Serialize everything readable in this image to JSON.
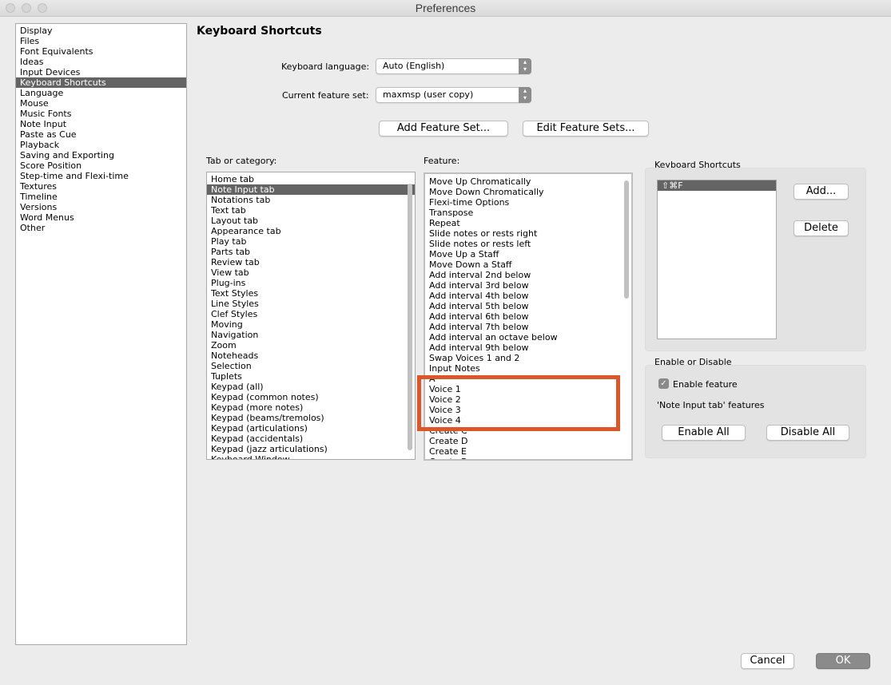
{
  "window": {
    "title": "Preferences"
  },
  "colors": {
    "accent_highlight": "#d9572b",
    "selection": "#646464"
  },
  "sidebar": {
    "items": [
      "Display",
      "Files",
      "Font Equivalents",
      "Ideas",
      "Input Devices",
      "Keyboard Shortcuts",
      "Language",
      "Mouse",
      "Music Fonts",
      "Note Input",
      "Paste as Cue",
      "Playback",
      "Saving and Exporting",
      "Score Position",
      "Step-time and Flexi-time",
      "Textures",
      "Timeline",
      "Versions",
      "Word Menus",
      "Other"
    ],
    "selected": "Keyboard Shortcuts"
  },
  "main": {
    "title": "Keyboard Shortcuts",
    "keyboard_language_label": "Keyboard language:",
    "keyboard_language_value": "Auto (English)",
    "feature_set_label": "Current feature set:",
    "feature_set_value": "maxmsp (user copy)",
    "add_feature_set": "Add Feature Set...",
    "edit_feature_sets": "Edit Feature Sets..."
  },
  "categories": {
    "label": "Tab or category:",
    "items": [
      "Home tab",
      "Note Input tab",
      "Notations tab",
      "Text tab",
      "Layout tab",
      "Appearance tab",
      "Play tab",
      "Parts tab",
      "Review tab",
      "View tab",
      "Plug-ins",
      "Text Styles",
      "Line Styles",
      "Clef Styles",
      "Moving",
      "Navigation",
      "Zoom",
      "Noteheads",
      "Selection",
      "Tuplets",
      "Keypad (all)",
      "Keypad (common notes)",
      "Keypad (more notes)",
      "Keypad (beams/tremolos)",
      "Keypad (articulations)",
      "Keypad (accidentals)",
      "Keypad (jazz articulations)",
      "Keyboard Window"
    ],
    "selected": "Note Input tab"
  },
  "features": {
    "label": "Feature:",
    "items": [
      "Move Up Chromatically",
      "Move Down Chromatically",
      "Flexi-time Options",
      "Transpose",
      "Repeat",
      "Slide notes or rests right",
      "Slide notes or rests left",
      "Move Up a Staff",
      "Move Down a Staff",
      "Add interval 2nd below",
      "Add interval 3rd below",
      "Add interval 4th below",
      "Add interval 5th below",
      "Add interval 6th below",
      "Add interval 7th below",
      "Add interval an octave below",
      "Add interval 9th below",
      "Swap Voices 1 and 2",
      "Input Notes",
      "A",
      "Voice 1",
      "Voice 2",
      "Voice 3",
      "Voice 4",
      "Create C",
      "Create D",
      "Create E",
      "Create F"
    ],
    "highlighted": [
      "Voice 1",
      "Voice 2",
      "Voice 3",
      "Voice 4"
    ]
  },
  "shortcuts": {
    "label": "Keyboard Shortcuts",
    "items": [
      "⇧⌘F"
    ],
    "add_button": "Add...",
    "delete_button": "Delete"
  },
  "enable": {
    "label": "Enable or Disable",
    "checkbox_label": "Enable feature",
    "checked": true,
    "features_note": "'Note Input tab' features",
    "enable_all": "Enable All",
    "disable_all": "Disable All"
  },
  "footer": {
    "cancel": "Cancel",
    "ok": "OK"
  }
}
